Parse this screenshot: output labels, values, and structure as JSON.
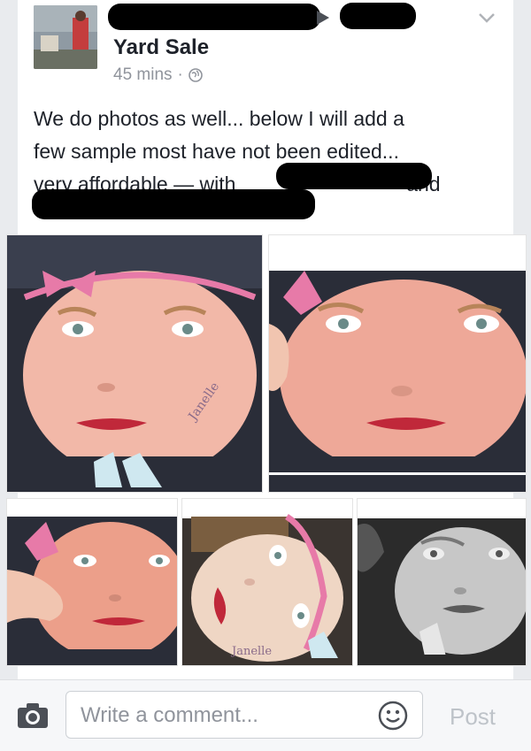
{
  "post": {
    "page_name": "Yard Sale",
    "timestamp": "45 mins",
    "separator": "·",
    "privacy_icon": "globe-icon",
    "text_lines": [
      "We do photos as well... below I will add a",
      "few sample most have not been edited...",
      "very affordable — with"
    ],
    "with_connector": "and"
  },
  "photos": {
    "signature": "Janelle",
    "count": 5
  },
  "comment_bar": {
    "placeholder": "Write a comment...",
    "post_label": "Post",
    "camera_icon": "camera-icon",
    "emoji_icon": "smiley-icon"
  },
  "colors": {
    "text": "#1d2129",
    "meta": "#90949c",
    "redaction": "#000000",
    "post_disabled": "#bec3c9"
  }
}
